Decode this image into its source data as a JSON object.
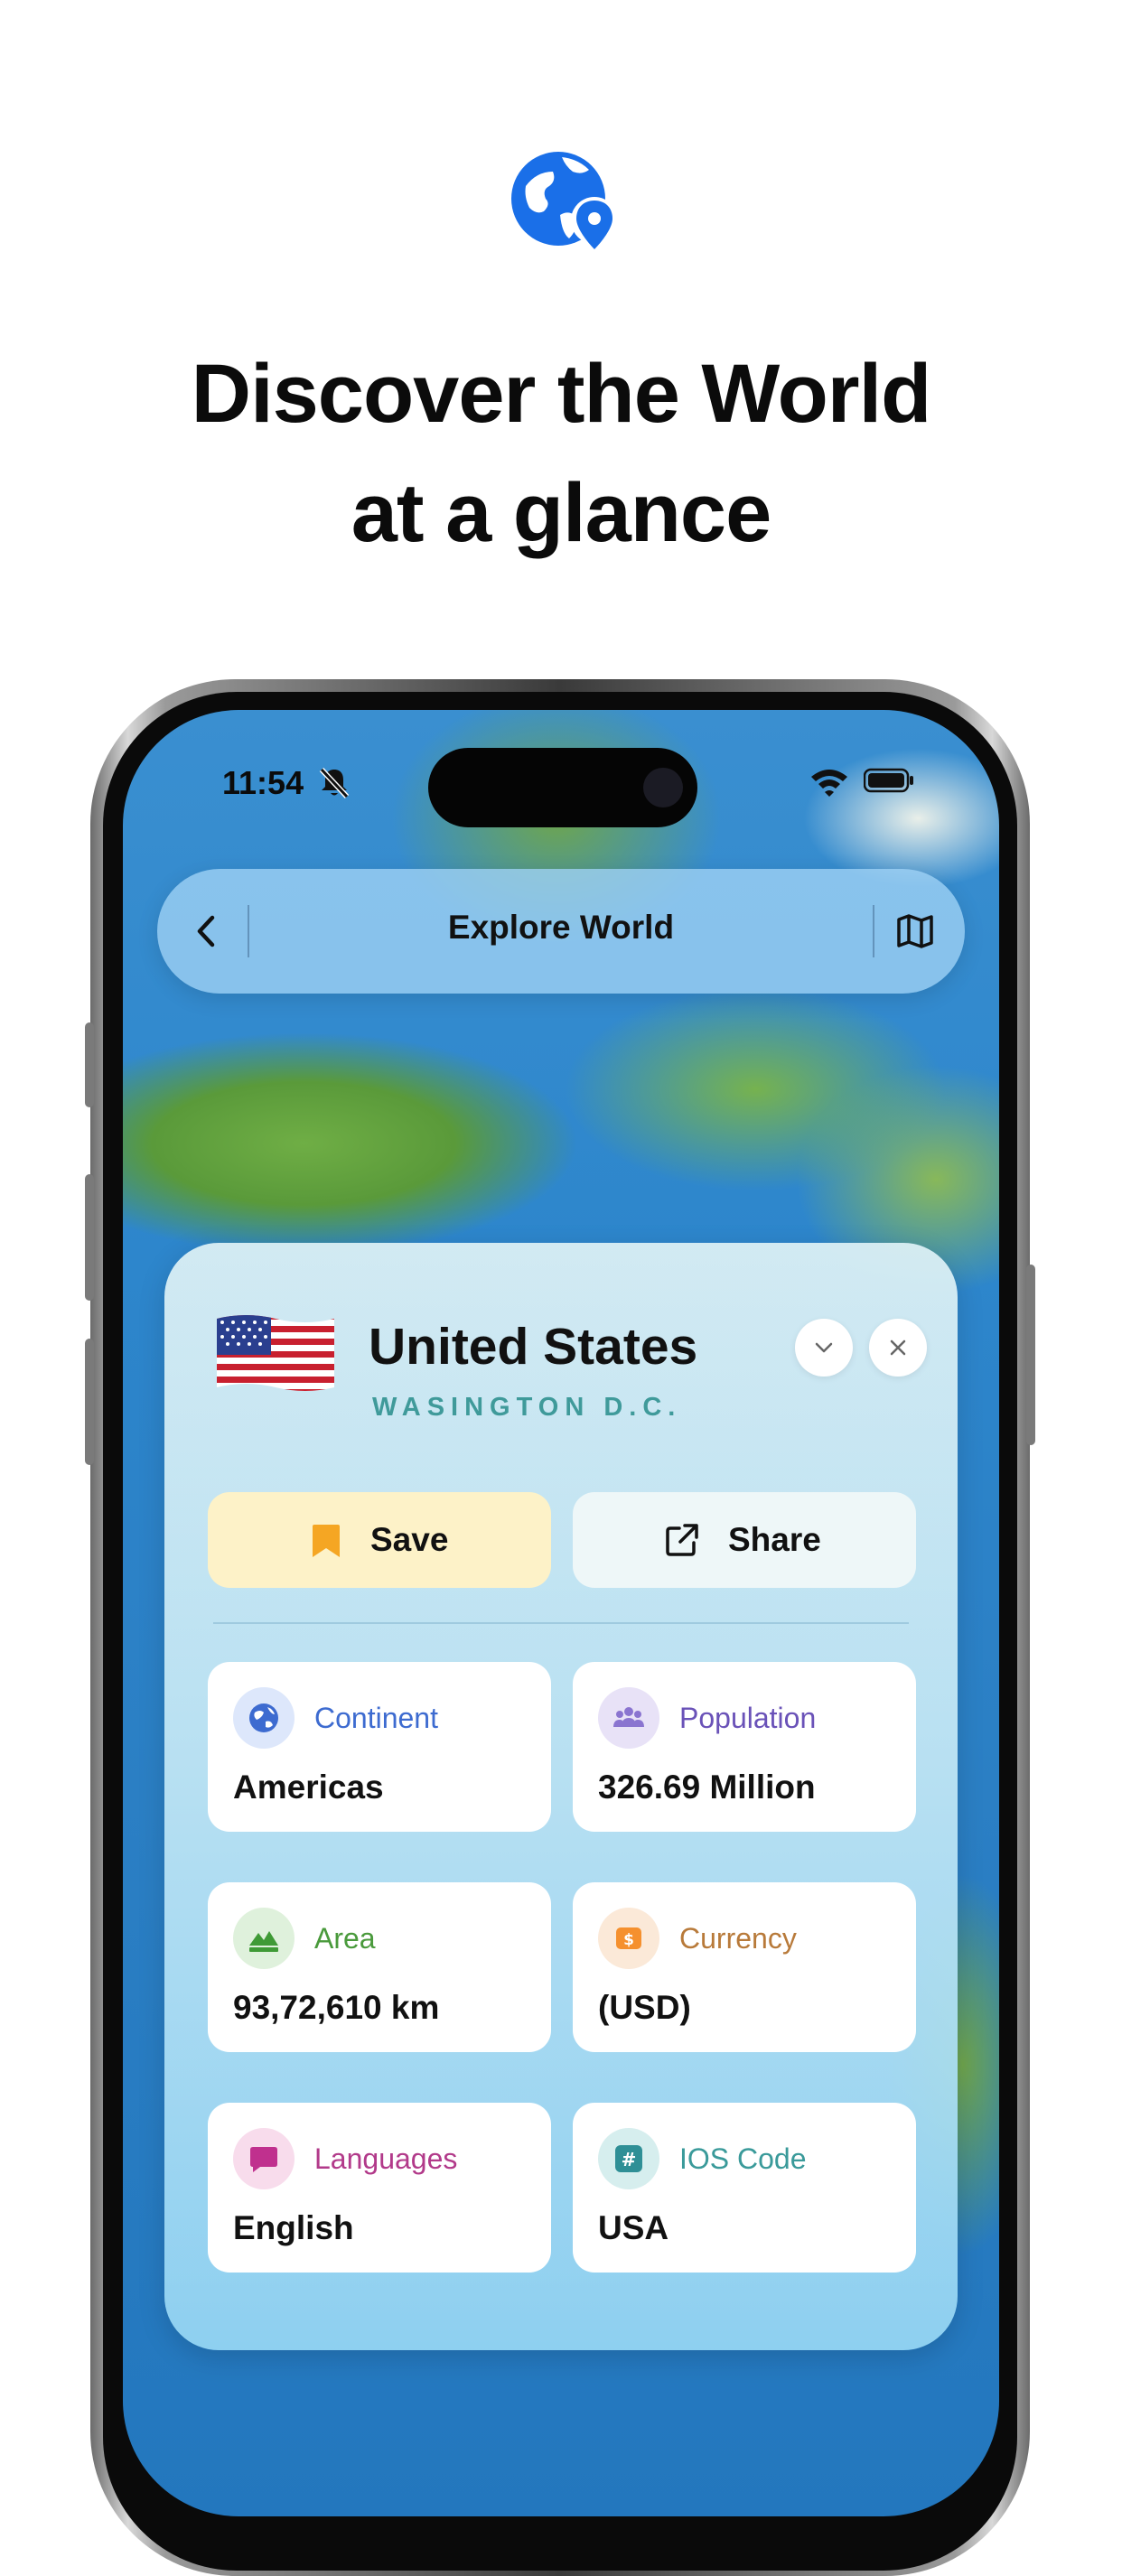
{
  "promo": {
    "headline_line1": "Discover the World",
    "headline_line2": "at a glance"
  },
  "status_bar": {
    "time": "11:54"
  },
  "navbar": {
    "title": "Explore World"
  },
  "country": {
    "name": "United States",
    "capital": "WASINGTON D.C.",
    "flag": "flag-usa"
  },
  "actions": {
    "save_label": "Save",
    "share_label": "Share"
  },
  "info": [
    {
      "label": "Continent",
      "value": "Americas",
      "icon": "globe-icon",
      "accent": "#3d6bd0"
    },
    {
      "label": "Population",
      "value": "326.69 Million",
      "icon": "people-icon",
      "accent": "#6a52b8"
    },
    {
      "label": "Area",
      "value": "93,72,610 km",
      "icon": "mountain-icon",
      "accent": "#4a9a3c"
    },
    {
      "label": "Currency",
      "value": "(USD)",
      "icon": "dollar-icon",
      "accent": "#b87a3a"
    },
    {
      "label": "Languages",
      "value": "English",
      "icon": "chat-bubble-icon",
      "accent": "#b23a8a"
    },
    {
      "label": "IOS Code",
      "value": "USA",
      "icon": "hashtag-icon",
      "accent": "#3a9a9a"
    }
  ],
  "colors": {
    "brand_blue": "#1a6fe8",
    "save_accent": "#f5a623"
  }
}
